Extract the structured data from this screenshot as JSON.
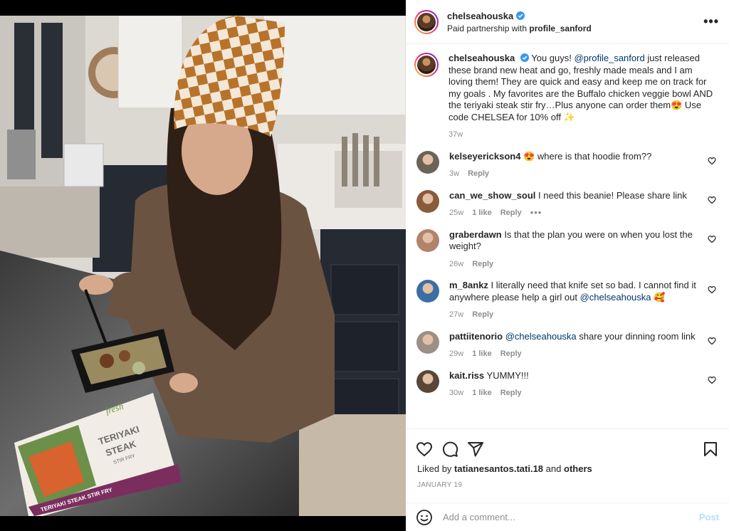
{
  "post": {
    "username": "chelseahouska",
    "partnership_prefix": "Paid partnership with",
    "partner": "profile_sanford",
    "more_label": "•••"
  },
  "caption": {
    "username": "chelseahouska",
    "text_1": "You guys!",
    "mention": "@profile_sanford",
    "text_2": "just released these brand new heat and go, freshly made meals and I am loving them! They are quick and easy and keep me on track for my goals . My favorites are the Buffalo chicken veggie bowl AND the teriyaki steak stir fry…Plus anyone can order them😍 Use code CHELSEA for 10% off ✨",
    "time": "37w"
  },
  "comments": [
    {
      "username": "kelseyerickson4",
      "text": "😍 where is that hoodie from??",
      "time": "3w",
      "likes": "",
      "reply": "Reply",
      "avatar_color": "#6b6258"
    },
    {
      "username": "can_we_show_soul",
      "text": "I need this beanie! Please share link",
      "time": "25w",
      "likes": "1 like",
      "reply": "Reply",
      "more": "•••",
      "avatar_color": "#8a5a3c"
    },
    {
      "username": "graberdawn",
      "text": "Is that the plan you were on when you lost the weight?",
      "time": "26w",
      "likes": "",
      "reply": "Reply",
      "avatar_color": "#b0836a"
    },
    {
      "username": "m_8ankz",
      "text": "I literally need that knife set so bad. I cannot find it anywhere please help a girl out",
      "mention": "@chelseahouska",
      "emoji": "🥰",
      "time": "27w",
      "likes": "",
      "reply": "Reply",
      "avatar_color": "#3b6ea5"
    },
    {
      "username": "pattiitenorio",
      "mention": "@chelseahouska",
      "text": "share your dinning room link",
      "time": "29w",
      "likes": "1 like",
      "reply": "Reply",
      "avatar_color": "#9c8f86"
    },
    {
      "username": "kait.riss",
      "text": "YUMMY!!!",
      "time": "30w",
      "likes": "1 like",
      "reply": "Reply",
      "avatar_color": "#5a4636"
    }
  ],
  "footer": {
    "liked_by_prefix": "Liked by",
    "liked_by_user": "tatianesantos.tati.18",
    "liked_by_and": "and",
    "liked_by_others": "others",
    "date": "JANUARY 19",
    "comment_placeholder": "Add a comment...",
    "post_label": "Post"
  },
  "photo": {
    "box_brand": "fresh",
    "box_title_1": "TERIYAKI",
    "box_title_2": "STEAK",
    "box_sub": "STIR FRY",
    "box_band": "TERIYAKI STEAK STIR FRY"
  },
  "colors": {
    "verified": "#3897f0",
    "mention": "#00376b",
    "muted": "#8e8e8e",
    "post_disabled": "#b2dffc"
  }
}
